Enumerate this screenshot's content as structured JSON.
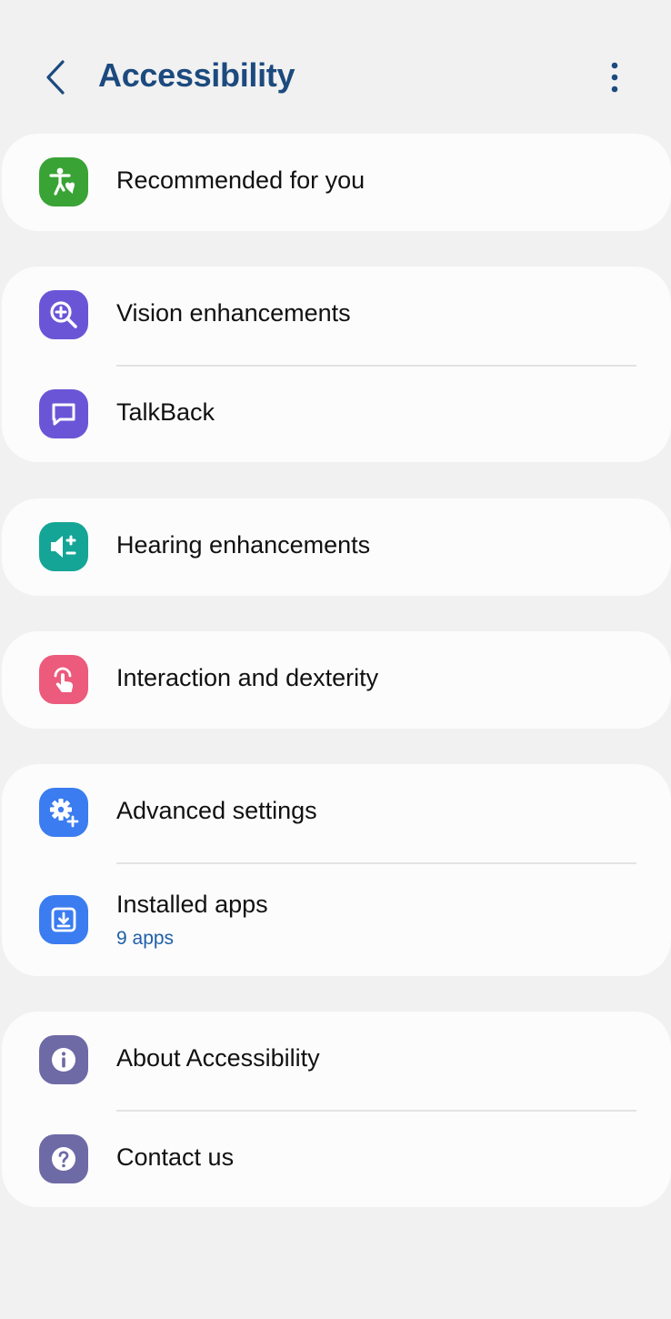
{
  "header": {
    "title": "Accessibility"
  },
  "colors": {
    "title": "#1c4a7e",
    "recommended": "#3aa335",
    "vision": "#6b55d7",
    "talkback": "#6b55d7",
    "hearing": "#15a596",
    "interaction": "#ec5a7c",
    "advanced": "#3b7cf0",
    "installed": "#3b7cf0",
    "about": "#6e6aa6",
    "contact": "#6e6aa6",
    "subtext": "#1f5fa8"
  },
  "menu": {
    "recommended": {
      "label": "Recommended for you",
      "icon": "accessibility-heart-icon"
    },
    "vision": {
      "label": "Vision enhancements",
      "icon": "magnifier-plus-icon"
    },
    "talkback": {
      "label": "TalkBack",
      "icon": "speech-bubble-icon"
    },
    "hearing": {
      "label": "Hearing enhancements",
      "icon": "speaker-plus-minus-icon"
    },
    "interaction": {
      "label": "Interaction and dexterity",
      "icon": "touch-hand-icon"
    },
    "advanced": {
      "label": "Advanced settings",
      "icon": "gear-plus-icon"
    },
    "installed": {
      "label": "Installed apps",
      "sub": "9 apps",
      "icon": "download-tray-icon"
    },
    "about": {
      "label": "About Accessibility",
      "icon": "info-icon"
    },
    "contact": {
      "label": "Contact us",
      "icon": "question-icon"
    }
  }
}
